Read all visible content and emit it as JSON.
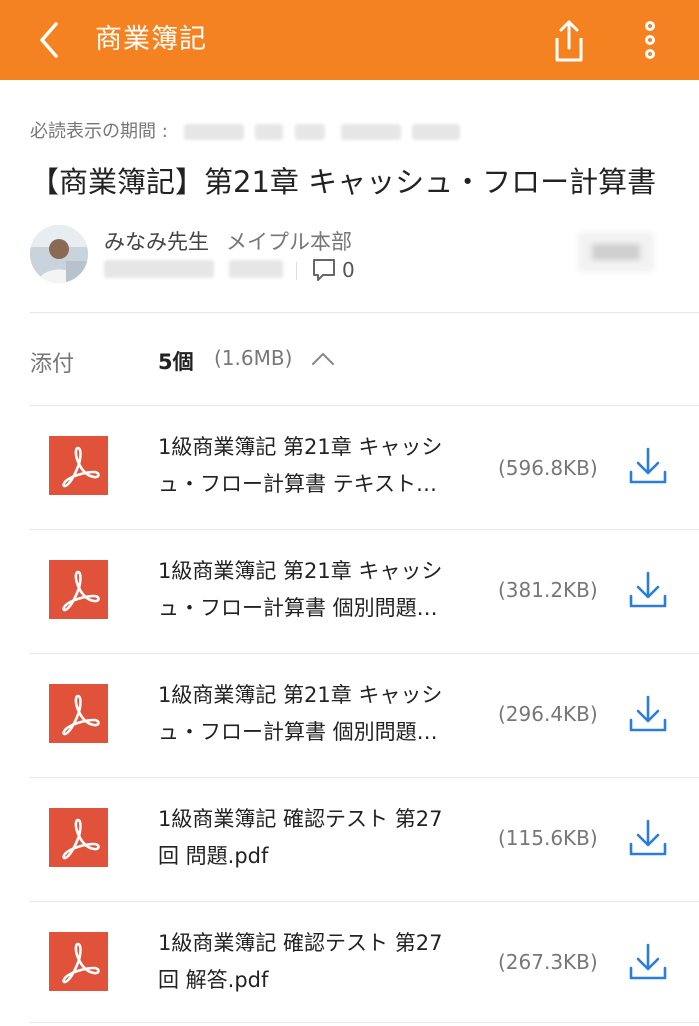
{
  "header": {
    "title": "商業簿記"
  },
  "post": {
    "period_label": "必読表示の期間 :",
    "title": "【商業簿記】第21章 キャッシュ・フロー計算書",
    "author_name": "みなみ先生",
    "author_org": "メイプル本部",
    "comment_count": "0"
  },
  "attachments": {
    "label": "添付",
    "count": "5個",
    "total_size": "(1.6MB)",
    "files": [
      {
        "line1": "1級商業簿記 第21章 キャッシ",
        "line2": "ュ・フロー計算書 テキスト…",
        "size": "(596.8KB)"
      },
      {
        "line1": "1級商業簿記 第21章 キャッシ",
        "line2": "ュ・フロー計算書 個別問題…",
        "size": "(381.2KB)"
      },
      {
        "line1": "1級商業簿記 第21章 キャッシ",
        "line2": "ュ・フロー計算書 個別問題…",
        "size": "(296.4KB)"
      },
      {
        "line1": "1級商業簿記 確認テスト 第27",
        "line2": "回 問題.pdf",
        "size": "(115.6KB)"
      },
      {
        "line1": "1級商業簿記 確認テスト 第27",
        "line2": "回 解答.pdf",
        "size": "(267.3KB)"
      }
    ]
  },
  "colors": {
    "accent": "#f58220",
    "pdf": "#e0533a",
    "download": "#2b7ddb"
  },
  "icons": [
    "back-arrow-icon",
    "share-icon",
    "more-vertical-icon",
    "comment-icon",
    "chevron-up-icon",
    "pdf-icon",
    "download-icon"
  ]
}
